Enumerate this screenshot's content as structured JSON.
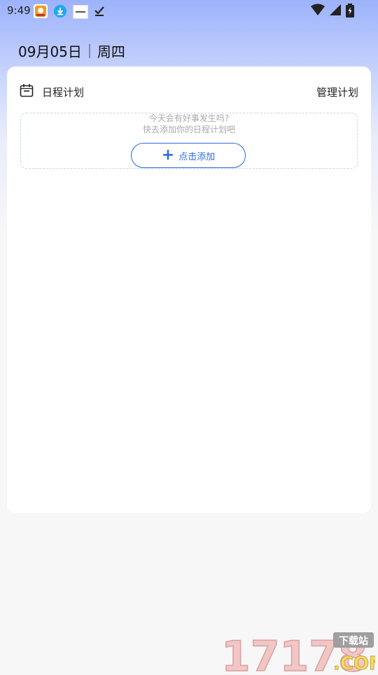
{
  "status_bar": {
    "time": "9:49",
    "notification_icons": [
      "app-badge-icon",
      "download-icon",
      "app-thumbnail-icon",
      "check-icon"
    ],
    "system_icons": [
      "wifi-icon",
      "signal-icon",
      "battery-charging-icon"
    ]
  },
  "header": {
    "date": "09月05日",
    "weekday": "周四"
  },
  "schedule_card": {
    "title": "日程计划",
    "manage_label": "管理计划",
    "empty_hint_line1": "今天会有好事发生吗?",
    "empty_hint_line2": "快去添加你的日程计划吧",
    "add_button_label": "点击添加"
  },
  "watermark": {
    "number": "17178",
    "suffix": ".COM",
    "tag": "下载站"
  },
  "colors": {
    "accent": "#2d6bdc",
    "gradient_top": "#9cb2fb",
    "background": "#f7f7f8"
  }
}
